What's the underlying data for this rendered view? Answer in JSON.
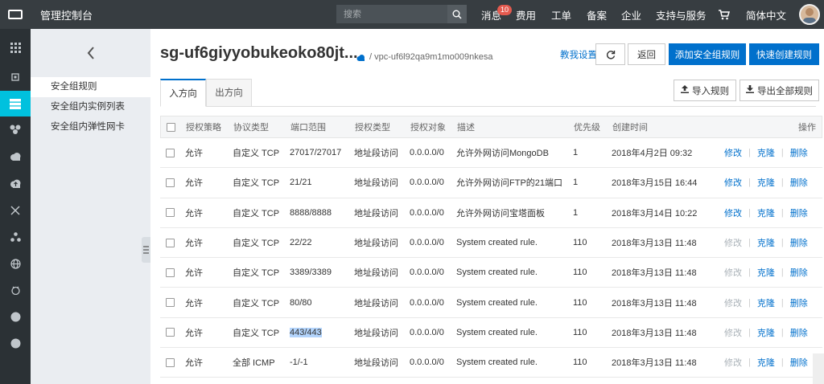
{
  "topbar": {
    "console_title": "管理控制台",
    "search_placeholder": "搜索",
    "nav": {
      "messages": "消息",
      "messages_badge": "10",
      "billing": "费用",
      "tickets": "工单",
      "filing": "备案",
      "enterprise": "企业",
      "support": "支持与服务",
      "language": "简体中文"
    }
  },
  "sidebar": {
    "items": [
      "安全组规则",
      "安全组内实例列表",
      "安全组内弹性网卡"
    ]
  },
  "header": {
    "sg_name": "sg-uf6giyyobukeoko80jt...",
    "vpc": "/ vpc-uf6l92qa9m1mo009nkesa",
    "help_link": "教我设置",
    "back_btn": "返回",
    "add_rule_btn": "添加安全组规则",
    "quick_create_btn": "快速创建规则",
    "import_btn": "导入规则",
    "export_btn": "导出全部规则"
  },
  "tabs": [
    "入方向",
    "出方向"
  ],
  "table": {
    "columns": [
      "授权策略",
      "协议类型",
      "端口范围",
      "授权类型",
      "授权对象",
      "描述",
      "优先级",
      "创建时间",
      "操作"
    ],
    "rows": [
      [
        "允许",
        "自定义 TCP",
        "27017/27017",
        "地址段访问",
        "0.0.0.0/0",
        "允许外网访问MongoDB",
        "1",
        "2018年4月2日 09:32"
      ],
      [
        "允许",
        "自定义 TCP",
        "21/21",
        "地址段访问",
        "0.0.0.0/0",
        "允许外网访问FTP的21端口",
        "1",
        "2018年3月15日 16:44"
      ],
      [
        "允许",
        "自定义 TCP",
        "8888/8888",
        "地址段访问",
        "0.0.0.0/0",
        "允许外网访问宝塔面板",
        "1",
        "2018年3月14日 10:22"
      ],
      [
        "允许",
        "自定义 TCP",
        "22/22",
        "地址段访问",
        "0.0.0.0/0",
        "System created rule.",
        "110",
        "2018年3月13日 11:48"
      ],
      [
        "允许",
        "自定义 TCP",
        "3389/3389",
        "地址段访问",
        "0.0.0.0/0",
        "System created rule.",
        "110",
        "2018年3月13日 11:48"
      ],
      [
        "允许",
        "自定义 TCP",
        "80/80",
        "地址段访问",
        "0.0.0.0/0",
        "System created rule.",
        "110",
        "2018年3月13日 11:48"
      ],
      [
        "允许",
        "自定义 TCP",
        "443/443",
        "地址段访问",
        "0.0.0.0/0",
        "System created rule.",
        "110",
        "2018年3月13日 11:48"
      ],
      [
        "允许",
        "全部 ICMP",
        "-1/-1",
        "地址段访问",
        "0.0.0.0/0",
        "System created rule.",
        "110",
        "2018年3月13日 11:48"
      ]
    ],
    "actions": [
      "修改",
      "克隆",
      "删除"
    ],
    "edit_disabled": [
      false,
      false,
      false,
      true,
      true,
      true,
      true,
      true
    ]
  },
  "colors": {
    "topbar": "#373d41",
    "rail": "#2b3135",
    "rail_active": "#00c1de",
    "primary": "#0070cc"
  }
}
